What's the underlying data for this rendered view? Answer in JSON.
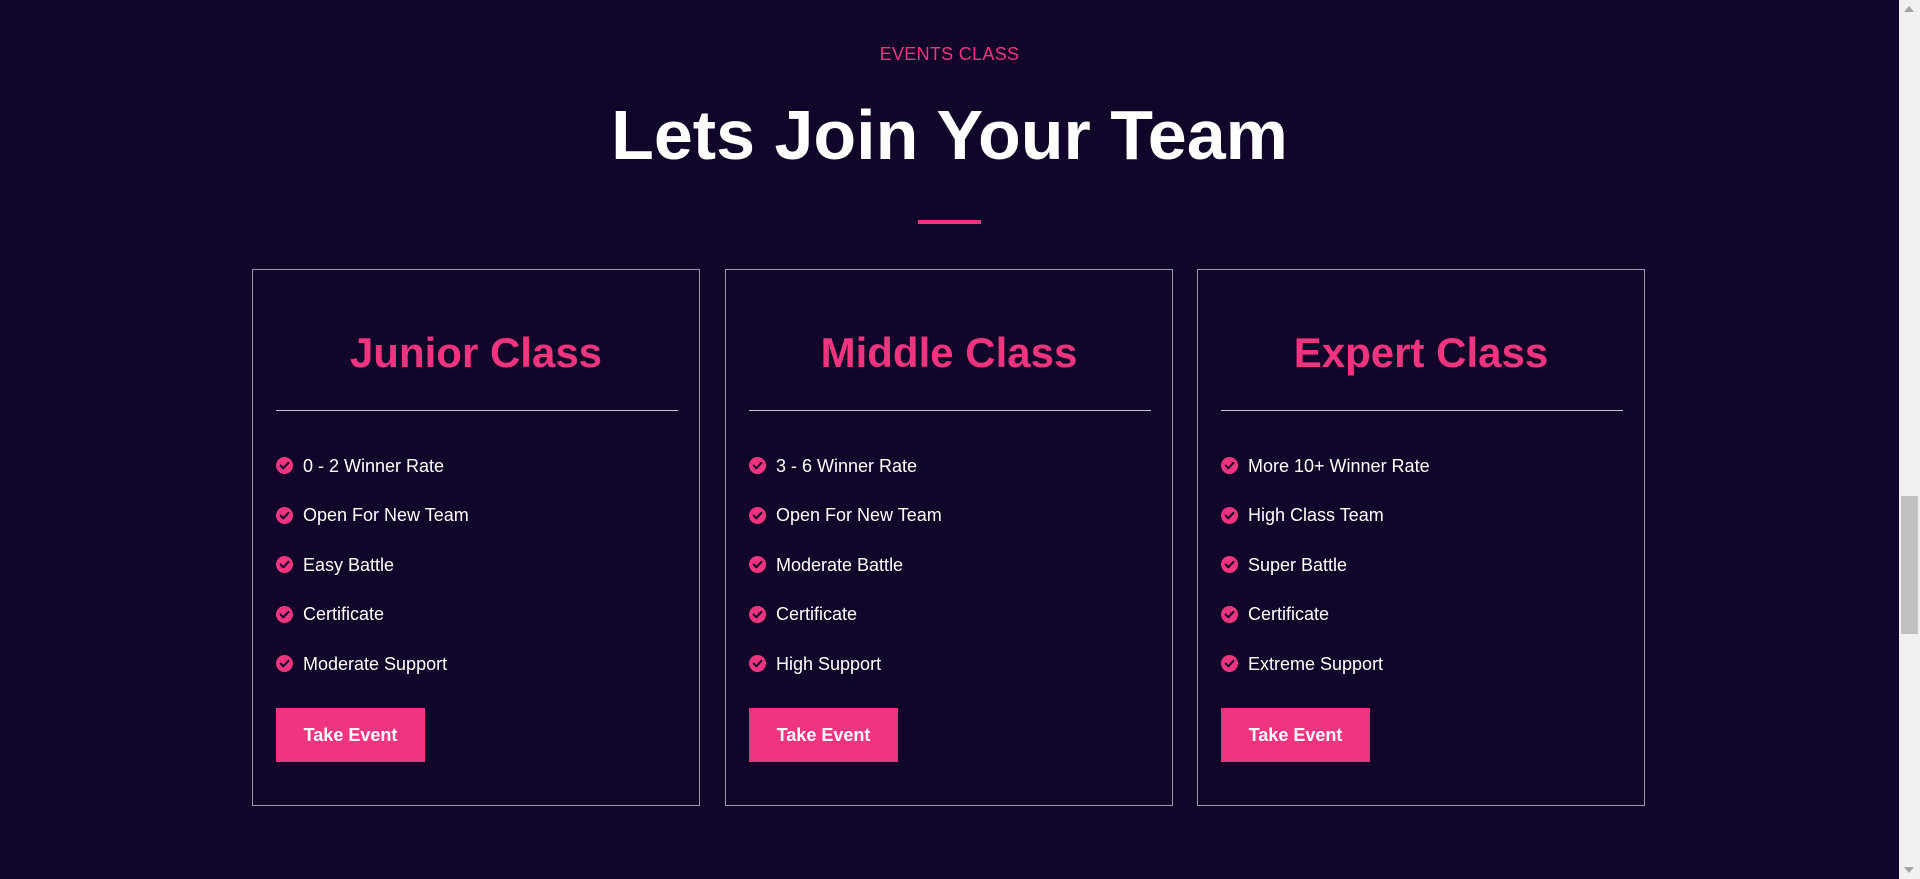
{
  "header": {
    "eyebrow": "EVENTS CLASS",
    "title": "Lets Join Your Team"
  },
  "colors": {
    "background": "#12052a",
    "accent": "#f0347f",
    "text": "#ffffff",
    "card_border": "#9c96ad"
  },
  "cards": [
    {
      "title": "Junior Class",
      "features": [
        "0 - 2 Winner Rate",
        "Open For New Team",
        "Easy Battle",
        "Certificate",
        "Moderate Support"
      ],
      "button_label": "Take Event"
    },
    {
      "title": "Middle Class",
      "features": [
        "3 - 6 Winner Rate",
        "Open For New Team",
        "Moderate Battle",
        "Certificate",
        "High Support"
      ],
      "button_label": "Take Event"
    },
    {
      "title": "Expert Class",
      "features": [
        "More 10+ Winner Rate",
        "High Class Team",
        "Super Battle",
        "Certificate",
        "Extreme Support"
      ],
      "button_label": "Take Event"
    }
  ],
  "icons": {
    "feature_icon": "check-circle-icon"
  }
}
